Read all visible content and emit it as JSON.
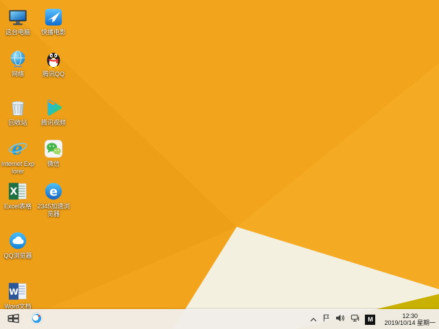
{
  "wallpaper": {
    "base_color": "#f2a41d",
    "facet_left_color": "#ee9f18",
    "facet_right_color": "#f5aa24",
    "facet_white_color": "#f3f0df",
    "facet_olive_color": "#c9b100"
  },
  "desktop": {
    "icons": [
      {
        "name": "this-pc",
        "label": "这台电脑"
      },
      {
        "name": "network",
        "label": "网络"
      },
      {
        "name": "recycle-bin",
        "label": "回收站"
      },
      {
        "name": "internet-explorer",
        "label": "Internet Explorer"
      },
      {
        "name": "excel",
        "label": "Excel表格"
      },
      {
        "name": "qq-browser",
        "label": "QQ浏览器"
      },
      {
        "name": "word",
        "label": "Word文档"
      },
      {
        "name": "kuaibo-movie",
        "label": "快播电影"
      },
      {
        "name": "tencent-qq",
        "label": "腾讯QQ"
      },
      {
        "name": "tencent-video",
        "label": "腾讯视频"
      },
      {
        "name": "wechat",
        "label": "微信"
      },
      {
        "name": "browser-2345",
        "label": "2345加速浏览器"
      }
    ]
  },
  "taskbar": {
    "tray": {
      "time": "12:30",
      "date": "2019/10/14 星期一",
      "ime_label": "M"
    }
  }
}
